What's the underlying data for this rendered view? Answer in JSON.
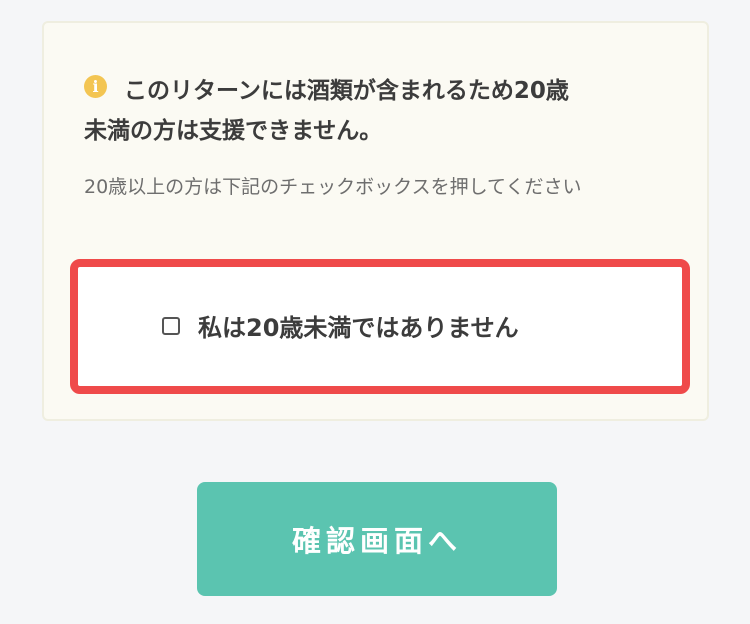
{
  "notice": {
    "icon": "info-icon",
    "warning_line1": "このリターンには酒類が含まれるため20歳",
    "warning_line2": "未満の方は支援できません。",
    "instruction": "20歳以上の方は下記のチェックボックスを押してください"
  },
  "confirm": {
    "label": "私は20歳未満ではありません",
    "checked": false
  },
  "submit": {
    "label": "確認画面へ"
  },
  "colors": {
    "background": "#f5f6f8",
    "panel": "#fbfaf3",
    "highlight_border": "#ef4a4a",
    "info_icon": "#f3c552",
    "button": "#5bc4b0"
  }
}
